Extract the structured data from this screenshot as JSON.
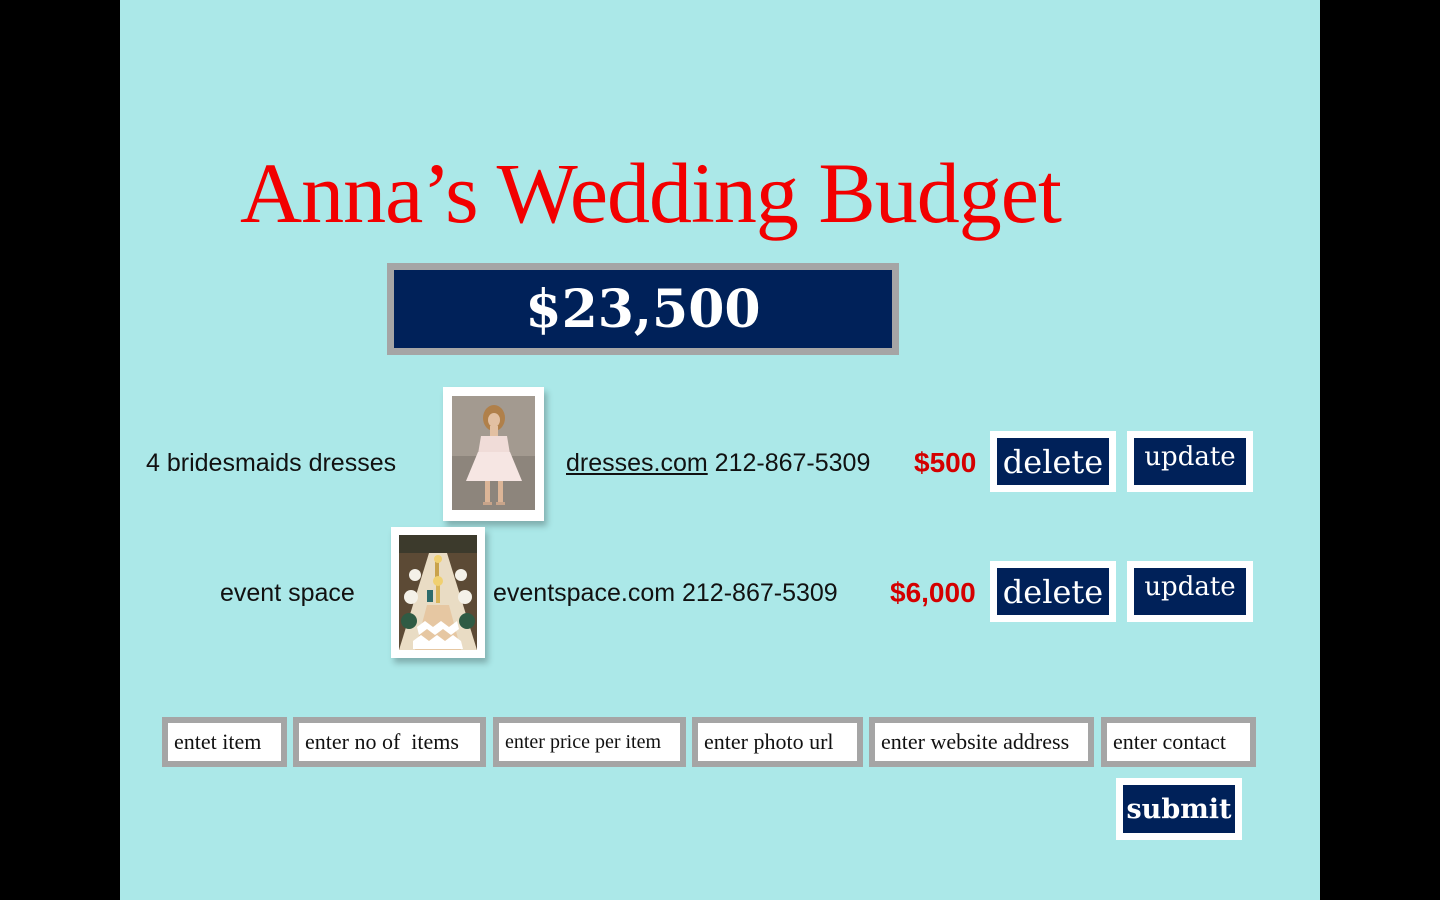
{
  "page": {
    "title": "Anna’s Wedding Budget",
    "total_budget": "$23,500"
  },
  "items": [
    {
      "name": "4 bridesmaids dresses",
      "photo": "bridesmaid dress photo",
      "website": "dresses.com",
      "phone": "212-867-5309",
      "price": "$500",
      "delete_label": "delete",
      "update_label": "update"
    },
    {
      "name": "event space",
      "photo": "event table setting photo",
      "website": "eventspace.com",
      "phone": "212-867-5309",
      "price": "$6,000",
      "delete_label": "delete",
      "update_label": "update"
    }
  ],
  "form": {
    "item_placeholder": "entet item",
    "quantity_placeholder": "enter no of  items",
    "price_placeholder": "enter price per item",
    "photo_placeholder": "enter photo url",
    "website_placeholder": "enter website address",
    "contact_placeholder": "enter contact",
    "submit_label": "submit"
  },
  "colors": {
    "background": "#abe8e8",
    "title": "#f20000",
    "navy": "#002159",
    "price": "#d40000",
    "frame_gray": "#a5a5a5"
  }
}
